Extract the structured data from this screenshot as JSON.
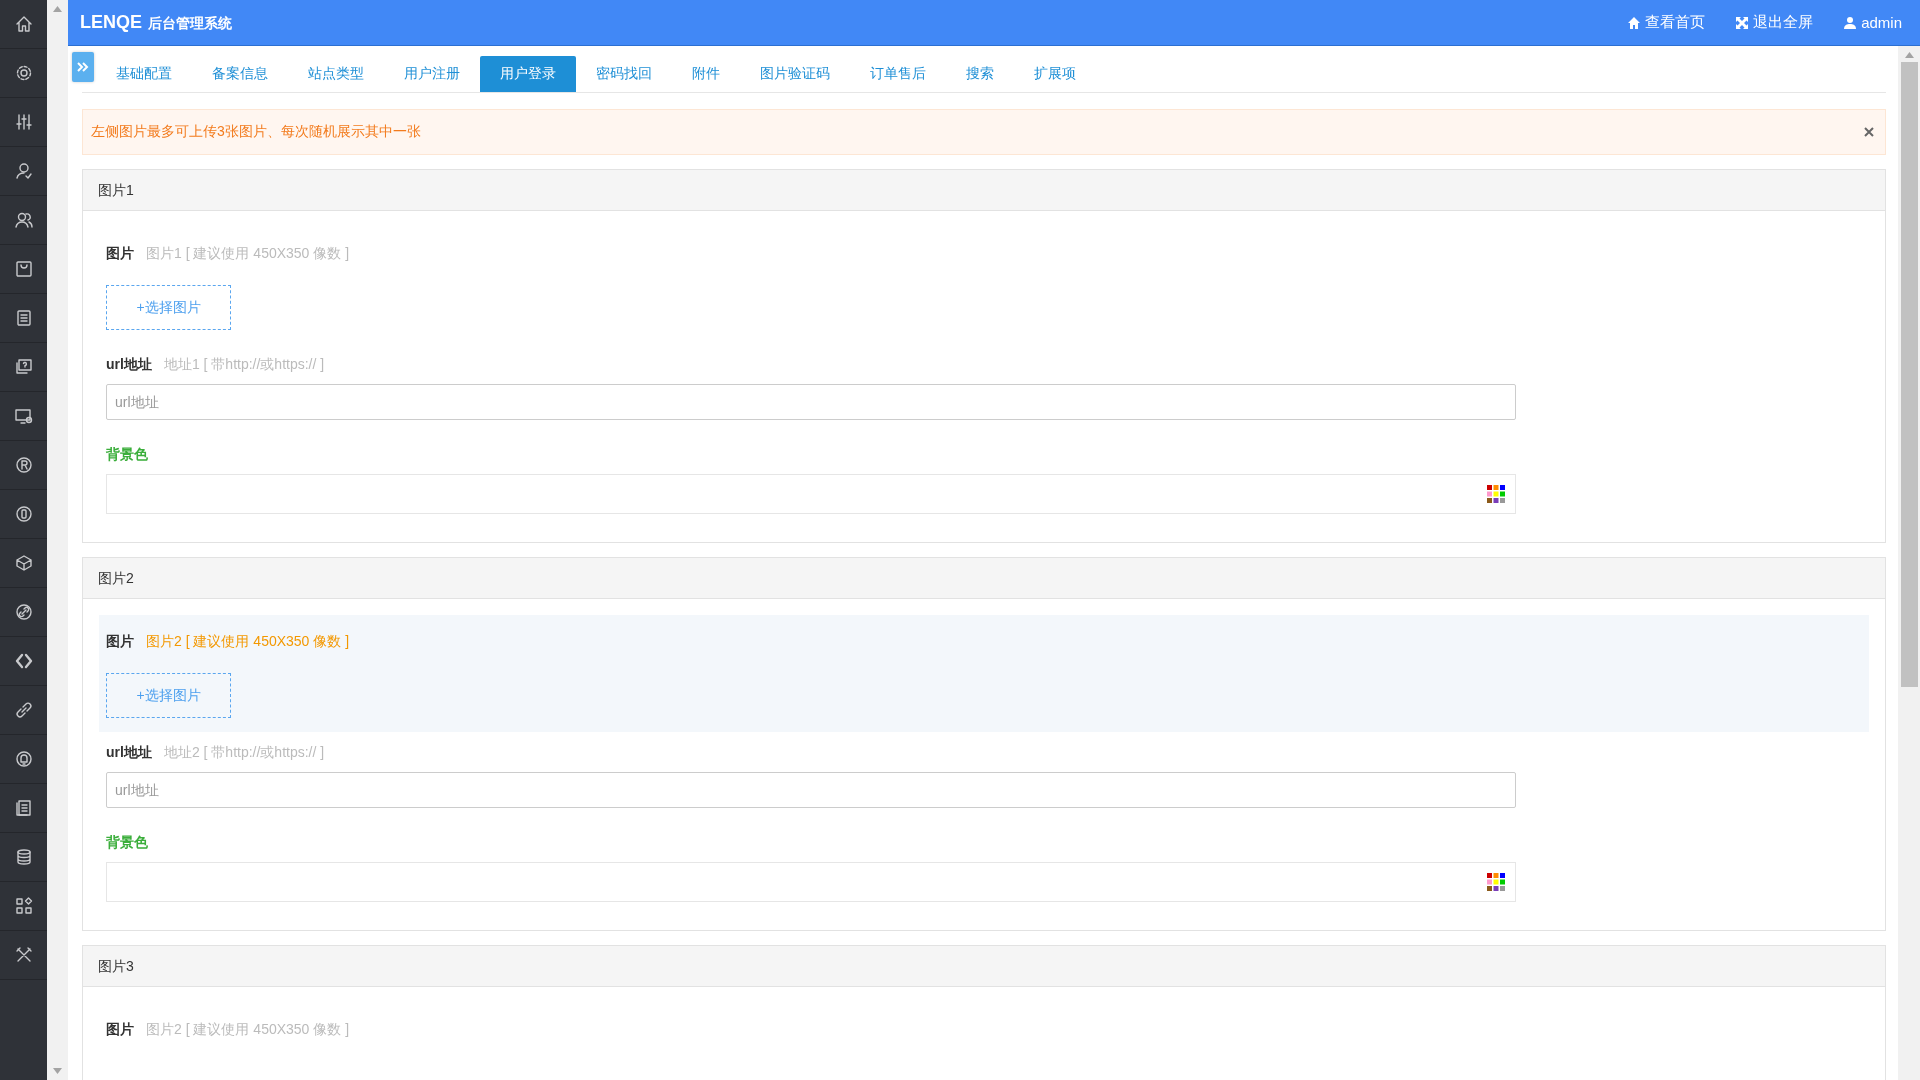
{
  "header": {
    "logo": "LENQE",
    "system_name": "后台管理系统",
    "links": [
      {
        "kind": "home",
        "label": "查看首页"
      },
      {
        "kind": "fullscreen",
        "label": "退出全屏"
      },
      {
        "kind": "user",
        "label": "admin"
      }
    ]
  },
  "tabs": [
    {
      "label": "基础配置",
      "selected": false
    },
    {
      "label": "备案信息",
      "selected": false
    },
    {
      "label": "站点类型",
      "selected": false
    },
    {
      "label": "用户注册",
      "selected": false
    },
    {
      "label": "用户登录",
      "selected": true
    },
    {
      "label": "密码找回",
      "selected": false
    },
    {
      "label": "附件",
      "selected": false
    },
    {
      "label": "图片验证码",
      "selected": false
    },
    {
      "label": "订单售后",
      "selected": false
    },
    {
      "label": "搜索",
      "selected": false
    },
    {
      "label": "扩展项",
      "selected": false
    }
  ],
  "alert": {
    "message": "左侧图片最多可上传3张图片、每次随机展示其中一张"
  },
  "panels": [
    {
      "title": "图片1",
      "image": {
        "label": "图片",
        "hint": "图片1 [ 建议使用 450X350 像数 ]",
        "highlighted": false,
        "button": "+选择图片"
      },
      "url": {
        "label": "url地址",
        "hint": "地址1 [ 带http://或https:// ]",
        "placeholder": "url地址"
      },
      "background": {
        "label": "背景色"
      }
    },
    {
      "title": "图片2",
      "image": {
        "label": "图片",
        "hint": "图片2 [ 建议使用 450X350 像数 ]",
        "highlighted": true,
        "button": "+选择图片"
      },
      "url": {
        "label": "url地址",
        "hint": "地址2 [ 带http://或https:// ]",
        "placeholder": "url地址"
      },
      "background": {
        "label": "背景色"
      }
    },
    {
      "title": "图片3",
      "image": {
        "label": "图片",
        "hint": "图片2 [ 建议使用 450X350 像数 ]",
        "highlighted": false
      }
    }
  ]
}
